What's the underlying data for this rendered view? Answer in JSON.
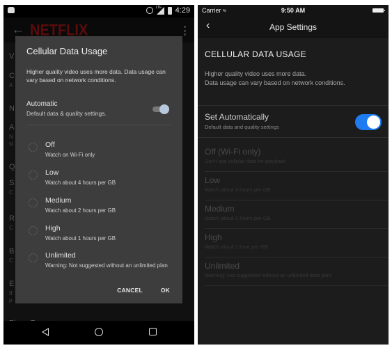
{
  "android": {
    "status_bar": {
      "notification_icon": "android-icon",
      "icons": [
        "alarm-icon",
        "lte-signal-icon",
        "battery-icon"
      ],
      "lte_label": "LTE",
      "time": "4:29"
    },
    "toolbar": {
      "back_icon": "arrow-left-icon",
      "logo": "NETFLIX",
      "menu_icon": "more-vert-icon"
    },
    "background_list_initials": [
      "V",
      "C",
      "A",
      "N",
      "A",
      "N",
      "sl",
      "Q",
      "S",
      "C",
      "R",
      "C",
      "B",
      "C",
      "E",
      "If",
      "p"
    ],
    "background_bottom_label": "Player Type",
    "dialog": {
      "title": "Cellular Data Usage",
      "description": "Higher quality video uses more data. Data usage can vary based on network conditions.",
      "automatic": {
        "label": "Automatic",
        "sublabel": "Default data & quality settings.",
        "enabled": true
      },
      "options": [
        {
          "label": "Off",
          "sublabel": "Watch on Wi-Fi only",
          "selected": false
        },
        {
          "label": "Low",
          "sublabel": "Watch about 4 hours per GB",
          "selected": false
        },
        {
          "label": "Medium",
          "sublabel": "Watch about 2 hours per GB",
          "selected": false
        },
        {
          "label": "High",
          "sublabel": "Watch about 1 hours per GB",
          "selected": false
        },
        {
          "label": "Unlimited",
          "sublabel": "Warning: Not suggested without an unlimited plan",
          "selected": false
        }
      ],
      "cancel_label": "CANCEL",
      "ok_label": "OK"
    },
    "nav_bar": {
      "back_icon": "triangle-back-icon",
      "home_icon": "circle-home-icon",
      "recents_icon": "square-recents-icon"
    }
  },
  "ios": {
    "status_bar": {
      "carrier": "Carrier",
      "wifi_icon": "wifi-icon",
      "time": "9:50 AM",
      "battery_icon": "battery-icon"
    },
    "nav": {
      "back_icon": "chevron-left-icon",
      "back_glyph": "‹",
      "title": "App Settings"
    },
    "section_title": "CELLULAR DATA USAGE",
    "description_line1": "Higher quality video uses more data.",
    "description_line2": "Data usage can vary based on network conditions.",
    "auto": {
      "label": "Set Automatically",
      "sublabel": "Default data and quality settings",
      "enabled": true,
      "switch_color": "#1f7cf0"
    },
    "options": [
      {
        "label": "Off (Wi-Fi only)",
        "sublabel": "Don't use cellular data for playback"
      },
      {
        "label": "Low",
        "sublabel": "Watch about 4 hours per GB"
      },
      {
        "label": "Medium",
        "sublabel": "Watch about 2 hours per GB"
      },
      {
        "label": "High",
        "sublabel": "Watch about 1 hour per GB"
      },
      {
        "label": "Unlimited",
        "sublabel": "Warning: Not suggested without an unlimited data plan."
      }
    ]
  }
}
